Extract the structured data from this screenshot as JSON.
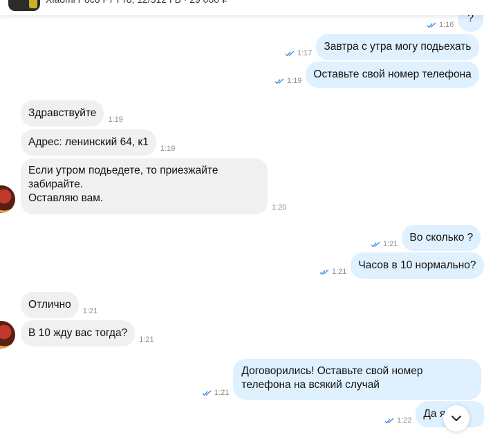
{
  "header": {
    "product_title": "Xiaomi Poco F7 Pro, 12/512 ГБ · 29 000 ₽"
  },
  "colors": {
    "outgoing_bubble": "#dff0ff",
    "incoming_bubble": "#f0f0f0",
    "read_check": "#3d8fe0"
  },
  "messages": [
    {
      "dir": "out",
      "text": "?",
      "time": "1:16"
    },
    {
      "dir": "out",
      "text": "Завтра с утра могу подьехать",
      "time": "1:17"
    },
    {
      "dir": "out",
      "text": "Оставьте свой номер телефона",
      "time": "1:19"
    },
    {
      "dir": "in",
      "text": "Здравствуйте",
      "time": "1:19"
    },
    {
      "dir": "in",
      "text": "Адрес: ленинский 64, к1",
      "time": "1:19"
    },
    {
      "dir": "in",
      "lines": [
        "Если утром подьедете, то приезжайте",
        "забирайте.",
        "Оставляю вам."
      ],
      "time": "1:20"
    },
    {
      "dir": "out",
      "text": "Во сколько ?",
      "time": "1:21"
    },
    {
      "dir": "out",
      "text": "Часов в 10 нормально?",
      "time": "1:21"
    },
    {
      "dir": "in",
      "text": "Отлично",
      "time": "1:21"
    },
    {
      "dir": "in",
      "text": "В 10 жду вас тогда?",
      "time": "1:21"
    },
    {
      "dir": "out",
      "lines": [
        "Договорились! Оставьте свой номер",
        "телефона на всякий случай"
      ],
      "time": "1:21"
    },
    {
      "dir": "out",
      "text": "Да я б",
      "time": "1:22"
    }
  ],
  "icons": {
    "read_receipt": "double-check-icon",
    "scroll_down": "chevron-down-icon",
    "avatar": "seller-avatar"
  }
}
